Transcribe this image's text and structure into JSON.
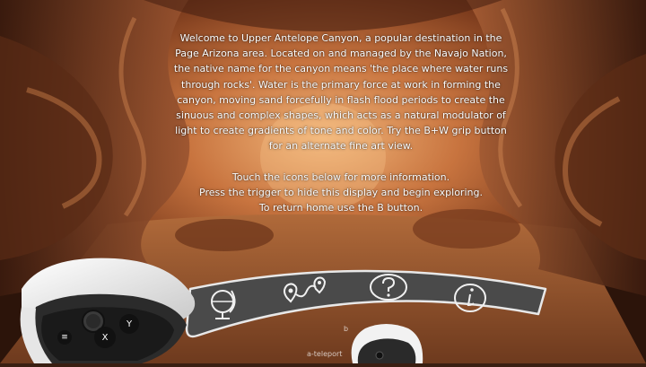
{
  "info": {
    "paragraph": "Welcome to Upper Antelope Canyon, a popular destination in the Page Arizona area. Located on and managed by the Navajo Nation, the native name for the canyon means 'the place where water runs through rocks'. Water is the primary force at work in forming the canyon, moving sand forcefully in flash flood periods to create the sinuous and complex shapes, which acts as a natural modulator of light to create gradients of tone and color. Try the B+W grip button for an alternate fine art view.",
    "instructions": [
      "Touch the icons below for more information.",
      "Press the trigger to hide this display and begin exploring.",
      "To return home use the B button."
    ]
  },
  "menu": {
    "buttons": [
      {
        "name": "globe-icon"
      },
      {
        "name": "teleport-path-icon"
      },
      {
        "name": "help-icon"
      },
      {
        "name": "info-icon"
      }
    ]
  },
  "controller": {
    "left_buttons": [
      "Y",
      "X",
      "≡"
    ]
  },
  "floor_labels": [
    "b",
    "a-teleport"
  ],
  "colors": {
    "panel": "#4a4a4a",
    "panel_border": "#e8e8e8",
    "icon": "#f0f0f0",
    "canyon_light": "#e89a55",
    "canyon_dark": "#3a1a0d"
  }
}
